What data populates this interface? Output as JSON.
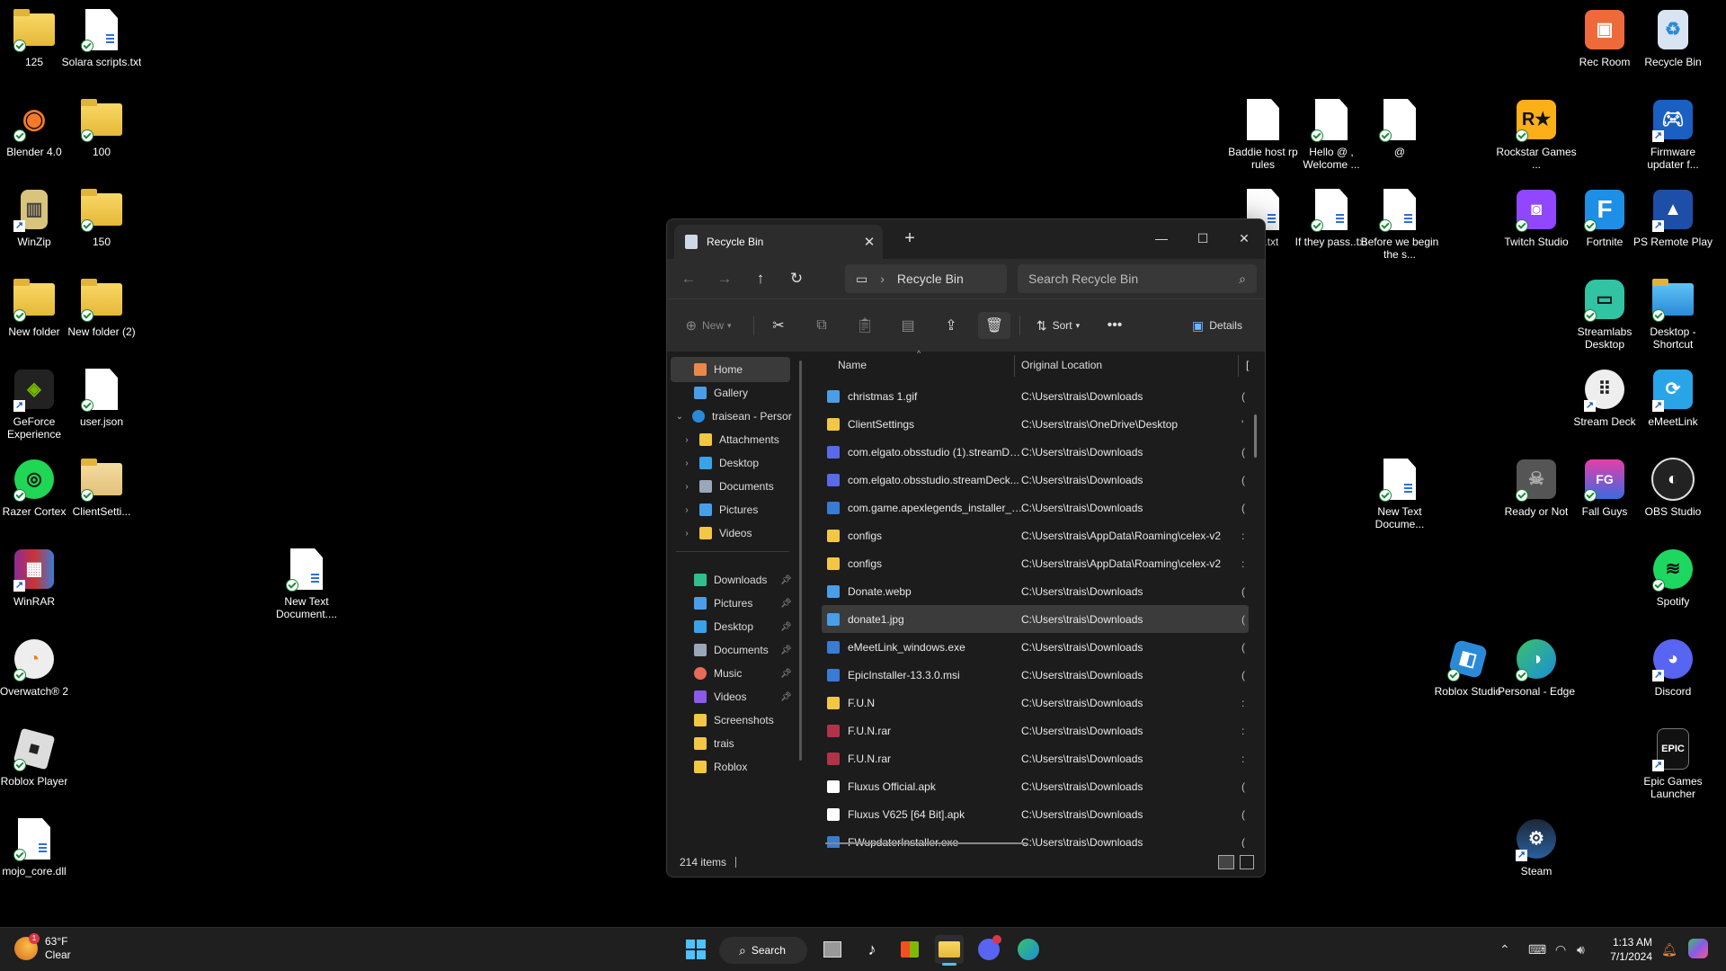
{
  "desktop": {
    "icons": {
      "i125": "125",
      "solara": "Solara scripts.txt",
      "blender": "Blender 4.0",
      "i100": "100",
      "winzip": "WinZip",
      "i150": "150",
      "newfolder": "New folder",
      "newfolder2": "New folder (2)",
      "geforce": "GeForce Experience",
      "userjson": "user.json",
      "razer": "Razer Cortex",
      "clientsettings": "ClientSetti...",
      "winrar": "WinRAR",
      "newtext1": "New Text Document....",
      "overwatch": "Overwatch® 2",
      "robloxplayer": "Roblox Player",
      "mojo": "mojo_core.dll",
      "baddie": "Baddie host rp rules",
      "hello": "Hello @ , Welcome ...",
      "at": "@",
      "fail": "fail..txt",
      "ifthey": "If they pass..txt",
      "beforewe": "Before we begin the s...",
      "newtext2": "New Text Docume...",
      "recroom": "Rec Room",
      "recyclebin": "Recycle Bin",
      "rockstar": "Rockstar Games ...",
      "firmware": "Firmware updater f...",
      "twitch": "Twitch Studio",
      "fortnite": "Fortnite",
      "psremote": "PS Remote Play",
      "streamlabs": "Streamlabs Desktop",
      "desktopshortcut": "Desktop - Shortcut",
      "streamdeck": "Stream Deck",
      "emeetlink": "eMeetLink",
      "readyornot": "Ready or Not",
      "fallguys": "Fall Guys",
      "obs": "OBS Studio",
      "spotify": "Spotify",
      "robloxstudio": "Roblox Studio",
      "edge": "Personal - Edge",
      "discord": "Discord",
      "epic": "Epic Games Launcher",
      "steam": "Steam"
    }
  },
  "explorer": {
    "tab_title": "Recycle Bin",
    "breadcrumb": "Recycle Bin",
    "search_placeholder": "Search Recycle Bin",
    "toolbar": {
      "new": "New",
      "sort": "Sort",
      "details": "Details"
    },
    "nav": {
      "home": "Home",
      "gallery": "Gallery",
      "onedrive": "traisean - Persor",
      "attachments": "Attachments",
      "desktop": "Desktop",
      "documents": "Documents",
      "pictures": "Pictures",
      "videos": "Videos",
      "q_downloads": "Downloads",
      "q_pictures": "Pictures",
      "q_desktop": "Desktop",
      "q_documents": "Documents",
      "q_music": "Music",
      "q_videos": "Videos",
      "q_screenshots": "Screenshots",
      "q_trais": "trais",
      "q_roblox": "Roblox"
    },
    "columns": {
      "name": "Name",
      "location": "Original Location",
      "extra": "["
    },
    "files": [
      {
        "name": "christmas 1.gif",
        "loc": "C:\\Users\\trais\\Downloads",
        "x": "("
      },
      {
        "name": "ClientSettings",
        "loc": "C:\\Users\\trais\\OneDrive\\Desktop",
        "x": "'"
      },
      {
        "name": "com.elgato.obsstudio (1).streamDe...",
        "loc": "C:\\Users\\trais\\Downloads",
        "x": "("
      },
      {
        "name": "com.elgato.obsstudio.streamDeck...",
        "loc": "C:\\Users\\trais\\Downloads",
        "x": "("
      },
      {
        "name": "com.game.apexlegends_installer_3...",
        "loc": "C:\\Users\\trais\\Downloads",
        "x": "("
      },
      {
        "name": "configs",
        "loc": "C:\\Users\\trais\\AppData\\Roaming\\celex-v2",
        "x": ":"
      },
      {
        "name": "configs",
        "loc": "C:\\Users\\trais\\AppData\\Roaming\\celex-v2",
        "x": ":"
      },
      {
        "name": "Donate.webp",
        "loc": "C:\\Users\\trais\\Downloads",
        "x": "("
      },
      {
        "name": "donate1.jpg",
        "loc": "C:\\Users\\trais\\Downloads",
        "x": "("
      },
      {
        "name": "eMeetLink_windows.exe",
        "loc": "C:\\Users\\trais\\Downloads",
        "x": "("
      },
      {
        "name": "EpicInstaller-13.3.0.msi",
        "loc": "C:\\Users\\trais\\Downloads",
        "x": "("
      },
      {
        "name": "F.U.N",
        "loc": "C:\\Users\\trais\\Downloads",
        "x": ":"
      },
      {
        "name": "F.U.N.rar",
        "loc": "C:\\Users\\trais\\Downloads",
        "x": ":"
      },
      {
        "name": "F.U.N.rar",
        "loc": "C:\\Users\\trais\\Downloads",
        "x": ":"
      },
      {
        "name": "Fluxus Official.apk",
        "loc": "C:\\Users\\trais\\Downloads",
        "x": "("
      },
      {
        "name": "Fluxus V625 [64 Bit].apk",
        "loc": "C:\\Users\\trais\\Downloads",
        "x": "("
      },
      {
        "name": "FWupdaterInstaller.exe",
        "loc": "C:\\Users\\trais\\Downloads",
        "x": "("
      }
    ],
    "status": "214 items"
  },
  "taskbar": {
    "weather_temp": "63°F",
    "weather_cond": "Clear",
    "search": "Search",
    "time": "1:13 AM",
    "date": "7/1/2024"
  }
}
